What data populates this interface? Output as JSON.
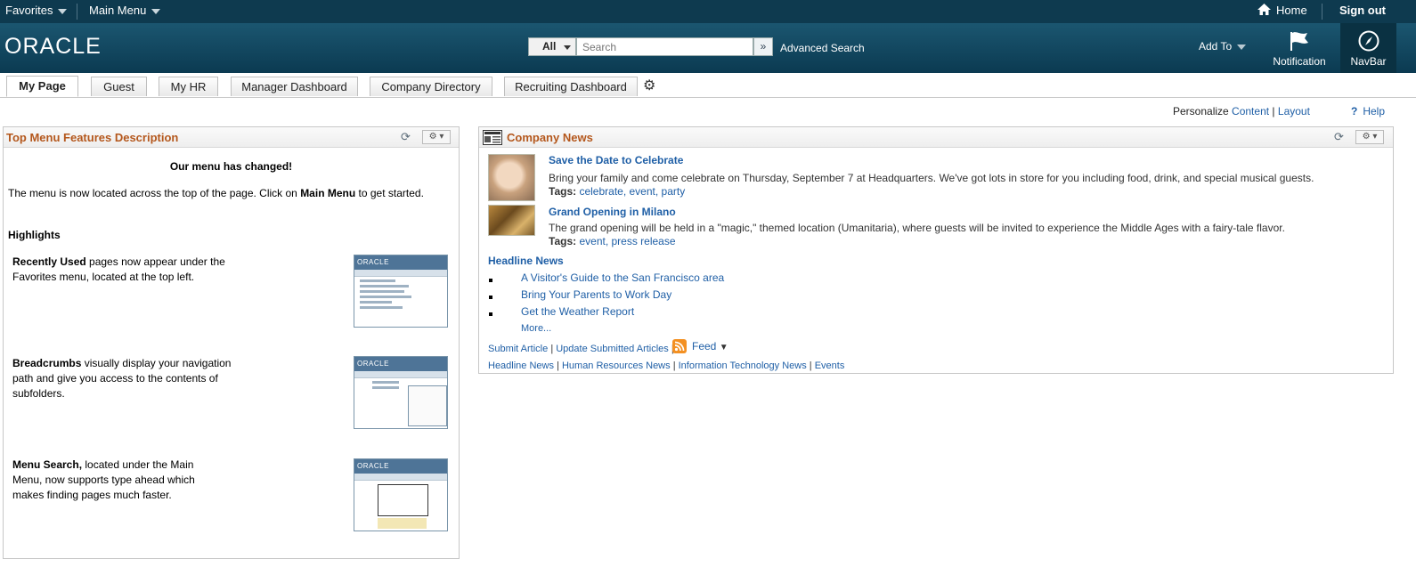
{
  "topbar": {
    "favorites": "Favorites",
    "main_menu": "Main Menu",
    "home": "Home",
    "sign_out": "Sign out"
  },
  "header": {
    "logo": "ORACLE",
    "search_scope": "All",
    "search_placeholder": "Search",
    "advanced_search": "Advanced Search",
    "add_to": "Add To",
    "notification": "Notification",
    "navbar": "NavBar"
  },
  "tabs": [
    {
      "label": "My Page",
      "active": true
    },
    {
      "label": "Guest"
    },
    {
      "label": "My HR"
    },
    {
      "label": "Manager Dashboard"
    },
    {
      "label": "Company Directory"
    },
    {
      "label": "Recruiting Dashboard"
    }
  ],
  "personalize": {
    "label": "Personalize",
    "content": "Content",
    "sep": "|",
    "layout": "Layout",
    "help": "Help"
  },
  "left_pagelet": {
    "title": "Top Menu Features Description",
    "heading": "Our menu has changed!",
    "intro_pre": "The menu is now located across the top of the page. Click on ",
    "intro_bold": "Main Menu",
    "intro_post": " to get started.",
    "highlights": "Highlights",
    "features": [
      {
        "bold": "Recently Used",
        "text": " pages now appear under the Favorites menu, located at the top left."
      },
      {
        "bold": "Breadcrumbs",
        "text": " visually display your navigation path and give you access to the contents of subfolders."
      },
      {
        "bold": "Menu Search,",
        "text": " located under the Main Menu, now supports type ahead which makes finding pages much faster."
      }
    ],
    "thumb_logo": "ORACLE"
  },
  "right_pagelet": {
    "title": "Company News",
    "articles": [
      {
        "title": "Save the Date to Celebrate",
        "desc": "Bring your family and come celebrate on Thursday, September 7 at Headquarters. We've got lots in store for you including food, drink, and special musical guests.",
        "tags_label": "Tags:",
        "tags": "celebrate, event, party"
      },
      {
        "title": "Grand Opening in Milano",
        "desc": "The grand opening will be held in a \"magic,\" themed location (Umanitaria), where guests will be invited to experience the Middle Ages with a fairy-tale flavor.",
        "tags_label": "Tags:",
        "tags": "event, press release"
      }
    ],
    "headline_title": "Headline News",
    "headlines": [
      "A Visitor's Guide to the San Francisco area",
      "Bring Your Parents to Work Day",
      "Get the Weather Report"
    ],
    "more": "More...",
    "submit_article": "Submit Article",
    "update_submitted": "Update Submitted Articles",
    "feed": "Feed",
    "footer_links": [
      "Headline News",
      "Human Resources News",
      "Information Technology News",
      "Events"
    ]
  }
}
